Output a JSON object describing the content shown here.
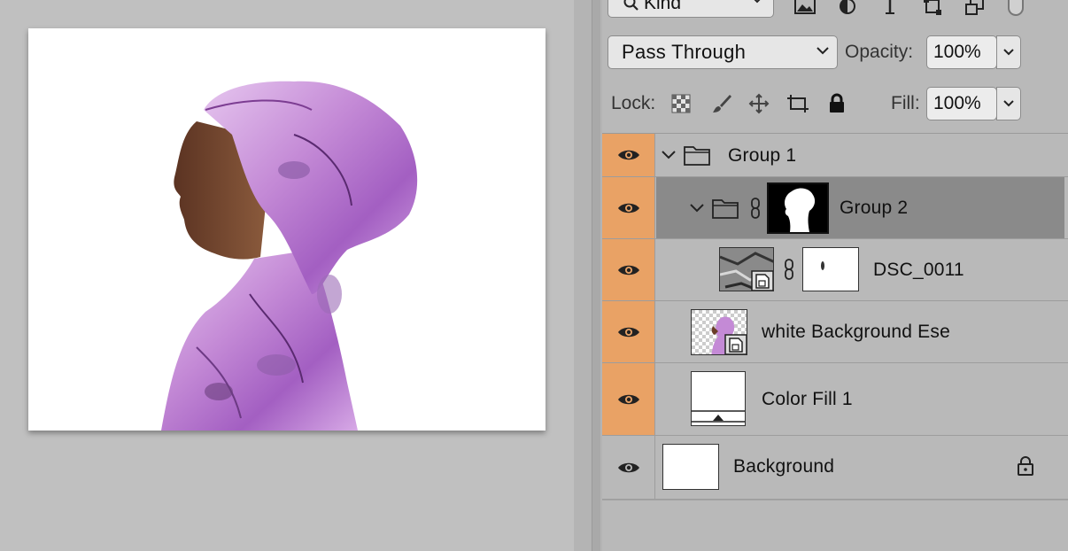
{
  "filter": {
    "kind_label": "Kind",
    "icons": [
      "image-filter-icon",
      "adjustment-filter-icon",
      "type-filter-icon",
      "shape-filter-icon",
      "smart-object-filter-icon"
    ]
  },
  "blend": {
    "mode": "Pass Through",
    "opacity_label": "Opacity:",
    "opacity_value": "100%"
  },
  "lock": {
    "label": "Lock:",
    "icons": [
      "lock-transparent-pixels-icon",
      "lock-image-pixels-icon",
      "lock-position-icon",
      "lock-artboard-icon",
      "lock-all-icon"
    ],
    "fill_label": "Fill:",
    "fill_value": "100%"
  },
  "layers": [
    {
      "name": "Group 1",
      "type": "group",
      "visible": true,
      "selected": false
    },
    {
      "name": "Group 2",
      "type": "group",
      "visible": true,
      "selected": true
    },
    {
      "name": "DSC_0011",
      "type": "smart-object",
      "visible": true,
      "selected": false
    },
    {
      "name": "white Background Ese",
      "type": "smart-object",
      "visible": true,
      "selected": false
    },
    {
      "name": "Color Fill 1",
      "type": "fill",
      "visible": true,
      "selected": false
    },
    {
      "name": "Background",
      "type": "background",
      "visible": true,
      "selected": false,
      "locked": true
    }
  ],
  "colors": {
    "visibility_column": "#e9a265",
    "selected_row": "#8a8a8a",
    "panel_bg": "#b9b9b9",
    "scarf_purple": "#c88fd6"
  }
}
